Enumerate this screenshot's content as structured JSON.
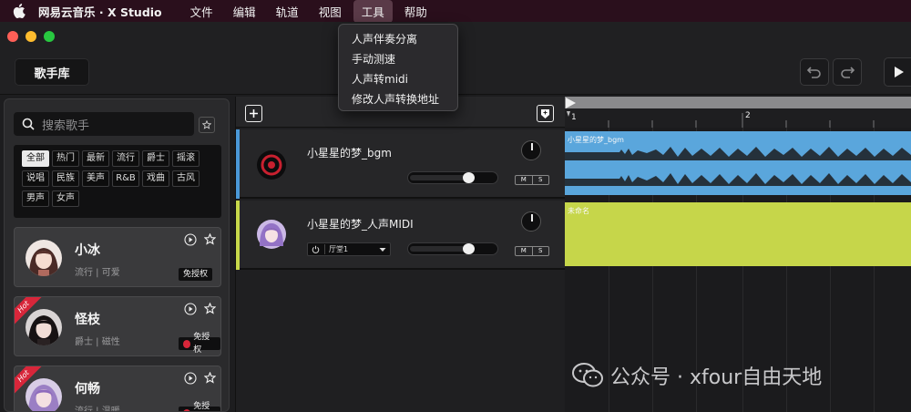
{
  "menubar": {
    "app_name": "网易云音乐 · X Studio",
    "items": [
      "文件",
      "编辑",
      "轨道",
      "视图",
      "工具",
      "帮助"
    ],
    "active_item": "工具"
  },
  "tools_menu": {
    "items": [
      "人声伴奏分离",
      "手动测速",
      "人声转midi",
      "修改人声转换地址"
    ]
  },
  "toolbar": {
    "singer_library_label": "歌手库"
  },
  "sidebar": {
    "search_placeholder": "搜索歌手",
    "tags": [
      "全部",
      "热门",
      "最新",
      "流行",
      "爵士",
      "摇滚",
      "说唱",
      "民族",
      "美声",
      "R&B",
      "戏曲",
      "古风",
      "男声",
      "女声"
    ],
    "selected_tag": "全部",
    "singers": [
      {
        "name": "小冰",
        "genre": "流行 | 可爱",
        "license": "免授权",
        "hot": false,
        "license_mark": false
      },
      {
        "name": "怪枝",
        "genre": "爵士 | 磁性",
        "license": "免授权",
        "hot": true,
        "hot_label": "Hot",
        "license_mark": true
      },
      {
        "name": "何畅",
        "genre": "流行 | 温暖",
        "license": "免授权",
        "hot": true,
        "hot_label": "Hot",
        "license_mark": true
      }
    ]
  },
  "tracks": [
    {
      "name": "小星星的梦_bgm",
      "stripe_color": "#4a98d8",
      "volume": 0.72,
      "mute_label": "M",
      "solo_label": "S"
    },
    {
      "name": "小星星的梦_人声MIDI",
      "stripe_color": "#c7d84a",
      "volume": 0.72,
      "preset": "厅堂1",
      "mute_label": "M",
      "solo_label": "S"
    }
  ],
  "arrange": {
    "ruler_marks": [
      "1",
      "2"
    ],
    "clips": [
      {
        "label": "小星星的梦_bgm",
        "color": "#5aa6dc"
      },
      {
        "label": "未命名",
        "color": "#c6d64a"
      }
    ]
  },
  "watermark": {
    "text": "公众号 · xfour自由天地"
  }
}
